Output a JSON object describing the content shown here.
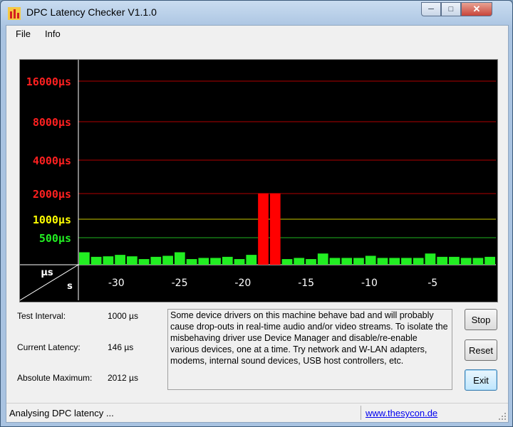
{
  "window": {
    "title": "DPC Latency Checker V1.1.0"
  },
  "menu": {
    "items": [
      "File",
      "Info"
    ]
  },
  "chart_data": {
    "type": "bar",
    "y_axis_unit_label": "µs",
    "x_axis_unit_label": "s",
    "y_scale": "log",
    "y_ticks": [
      {
        "label": "16000µs",
        "value": 16000,
        "color": "#ff2020"
      },
      {
        "label": "8000µs",
        "value": 8000,
        "color": "#ff2020"
      },
      {
        "label": "4000µs",
        "value": 4000,
        "color": "#ff2020"
      },
      {
        "label": "2000µs",
        "value": 2000,
        "color": "#ff2020"
      },
      {
        "label": "1000µs",
        "value": 1000,
        "color": "#ffff00"
      },
      {
        "label": "500µs",
        "value": 500,
        "color": "#22ee22"
      }
    ],
    "x_ticks": [
      -30,
      -25,
      -20,
      -15,
      -10,
      -5
    ],
    "xlim": [
      -33,
      0
    ],
    "series": [
      {
        "values": [
          210,
          160,
          165,
          180,
          165,
          140,
          160,
          170,
          210,
          140,
          150,
          150,
          160,
          140,
          180,
          2012,
          2012,
          140,
          150,
          140,
          195,
          150,
          150,
          150,
          170,
          150,
          150,
          150,
          150,
          195,
          160,
          160,
          150,
          150,
          160
        ]
      }
    ]
  },
  "info": {
    "test_interval_label": "Test Interval:",
    "test_interval_value": "1000 µs",
    "current_latency_label": "Current Latency:",
    "current_latency_value": "146 µs",
    "absolute_max_label": "Absolute Maximum:",
    "absolute_max_value": "2012 µs"
  },
  "message": "Some device drivers on this machine behave bad and will probably cause drop-outs in real-time audio and/or video streams. To isolate the misbehaving driver use Device Manager and disable/re-enable various devices, one at a time. Try network and W-LAN adapters, modems, internal sound devices, USB host controllers, etc.",
  "buttons": {
    "stop": "Stop",
    "reset": "Reset",
    "exit": "Exit"
  },
  "status": {
    "text": "Analysing DPC latency ...",
    "link": "www.thesycon.de"
  },
  "colors": {
    "bar_normal": "#22ee22",
    "bar_alert": "#ff0000",
    "chart_bg": "#000000"
  }
}
